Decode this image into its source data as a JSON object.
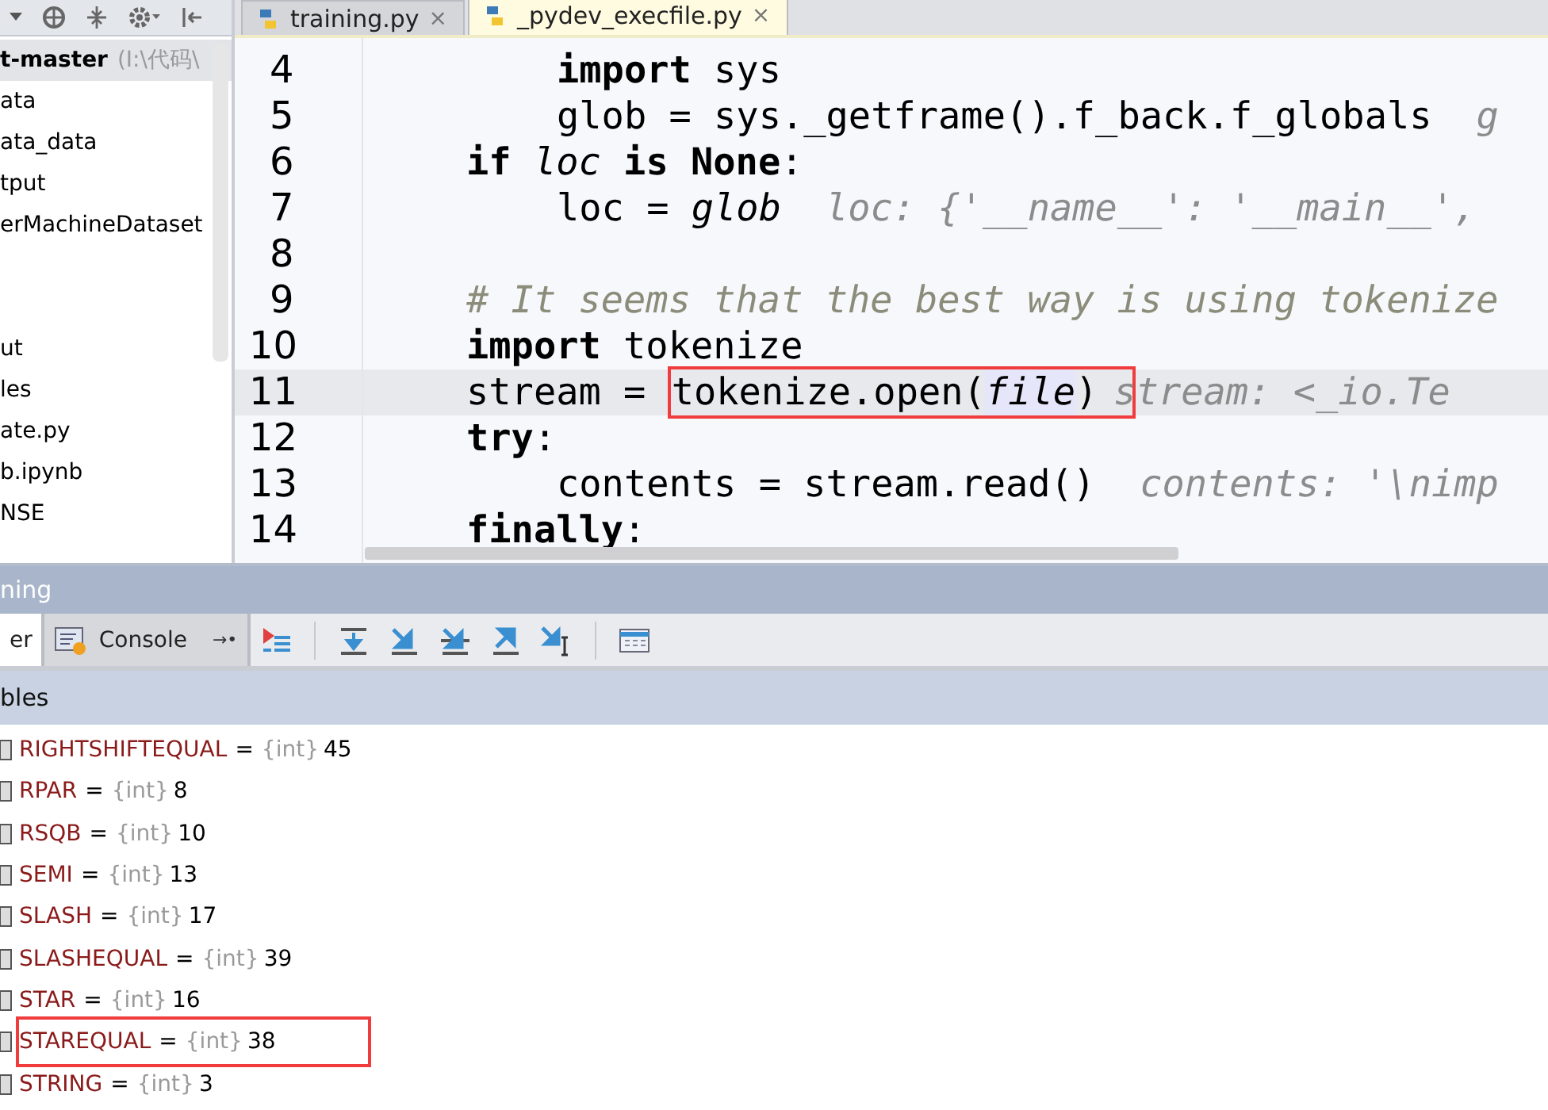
{
  "project_tree": {
    "items": [
      {
        "label": "t-master",
        "path": "(I:\\代码\\",
        "selected": true
      },
      {
        "label": "ata",
        "selected": false
      },
      {
        "label": "ata_data",
        "selected": false
      },
      {
        "label": "tput",
        "selected": false
      },
      {
        "label": "erMachineDataset",
        "selected": false
      },
      {
        "label": "ut",
        "selected": false,
        "gap_before": true
      },
      {
        "label": "les",
        "selected": false
      },
      {
        "label": "ate.py",
        "selected": false
      },
      {
        "label": "b.ipynb",
        "selected": false
      },
      {
        "label": "NSE",
        "selected": false
      }
    ]
  },
  "tabs": [
    {
      "label": "training.py",
      "close": "×",
      "selected": false
    },
    {
      "label": "_pydev_execfile.py",
      "close": "×",
      "selected": true
    }
  ],
  "editor": {
    "lines": [
      {
        "children": [
          {
            "number": "4",
            "current": false,
            "segments": [
              {
                "kind": "keyword",
                "text": "import"
              },
              {
                "kind": "plain",
                "text": " sys"
              }
            ]
          },
          {
            "number": "5",
            "current": false,
            "segments": [
              {
                "kind": "plain",
                "text": "glob = sys._getframe().f_back.f_globals"
              },
              {
                "kind": "hint",
                "text": "g"
              }
            ]
          }
        ]
      },
      {
        "number": "6",
        "current": false,
        "segments": [
          {
            "kind": "keyword",
            "text": "if "
          },
          {
            "kind": "italic",
            "text": "loc"
          },
          {
            "kind": "keyword",
            "text": " is None"
          },
          {
            "kind": "plain",
            "text": ":"
          }
        ],
        "children": [
          {
            "number": "7",
            "current": false,
            "segments": [
              {
                "kind": "plain",
                "text": "loc = "
              },
              {
                "kind": "italic",
                "text": "glob"
              },
              {
                "kind": "hint",
                "text": "loc: {'__name__': '__main__',"
              }
            ]
          }
        ]
      },
      {
        "number": "8",
        "current": false
      },
      {
        "number": "9",
        "current": false,
        "segments": [
          {
            "kind": "comment",
            "text": "# It seems that the best way is using tokenize"
          }
        ]
      },
      {
        "number": "10",
        "current": false,
        "segments": [
          {
            "kind": "keyword",
            "text": "import"
          },
          {
            "kind": "plain",
            "text": " tokenize"
          }
        ]
      },
      {
        "number": "11",
        "current": true,
        "annotated": true,
        "segments": [
          {
            "kind": "plain",
            "text": "stream = "
          },
          {
            "kind": "plain",
            "text": "tokenize.open("
          },
          {
            "kind": "param",
            "text": "file"
          },
          {
            "kind": "plain",
            "text": ")"
          },
          {
            "kind": "hint",
            "text": "stream: <_io.Te"
          }
        ]
      },
      {
        "number": "12",
        "current": false,
        "segments": [
          {
            "kind": "keyword",
            "text": "try"
          },
          {
            "kind": "plain",
            "text": ":"
          }
        ],
        "children": [
          {
            "number": "13",
            "current": false,
            "segments": [
              {
                "kind": "plain",
                "text": "contents = stream.read()"
              },
              {
                "kind": "hint",
                "text": "contents: '\\nimp"
              }
            ]
          }
        ]
      },
      {
        "number": "14",
        "current": false,
        "segments": [
          {
            "kind": "keyword",
            "text": "finally"
          },
          {
            "kind": "plain",
            "text": ":"
          }
        ]
      }
    ]
  },
  "debug_panel": {
    "title": "ning",
    "tabs": [
      {
        "label": "er",
        "selected": true
      },
      {
        "label": "Console",
        "pin": "→•",
        "selected": false
      }
    ],
    "variables_header": "bles",
    "variables": [
      {
        "name": "RIGHTSHIFTEQUAL",
        "operator": "=",
        "type": "{int}",
        "value": "45",
        "annotated": false
      },
      {
        "name": "RPAR",
        "operator": "=",
        "type": "{int}",
        "value": "8",
        "annotated": false
      },
      {
        "name": "RSQB",
        "operator": "=",
        "type": "{int}",
        "value": "10",
        "annotated": false
      },
      {
        "name": "SEMI",
        "operator": "=",
        "type": "{int}",
        "value": "13",
        "annotated": false
      },
      {
        "name": "SLASH",
        "operator": "=",
        "type": "{int}",
        "value": "17",
        "annotated": false
      },
      {
        "name": "SLASHEQUAL",
        "operator": "=",
        "type": "{int}",
        "value": "39",
        "annotated": false
      },
      {
        "name": "STAR",
        "operator": "=",
        "type": "{int}",
        "value": "16",
        "annotated": false
      },
      {
        "name": "STAREQUAL",
        "operator": "=",
        "type": "{int}",
        "value": "38",
        "annotated": true
      },
      {
        "name": "STRING",
        "operator": "=",
        "type": "{int}",
        "value": "3",
        "annotated": false
      }
    ]
  }
}
